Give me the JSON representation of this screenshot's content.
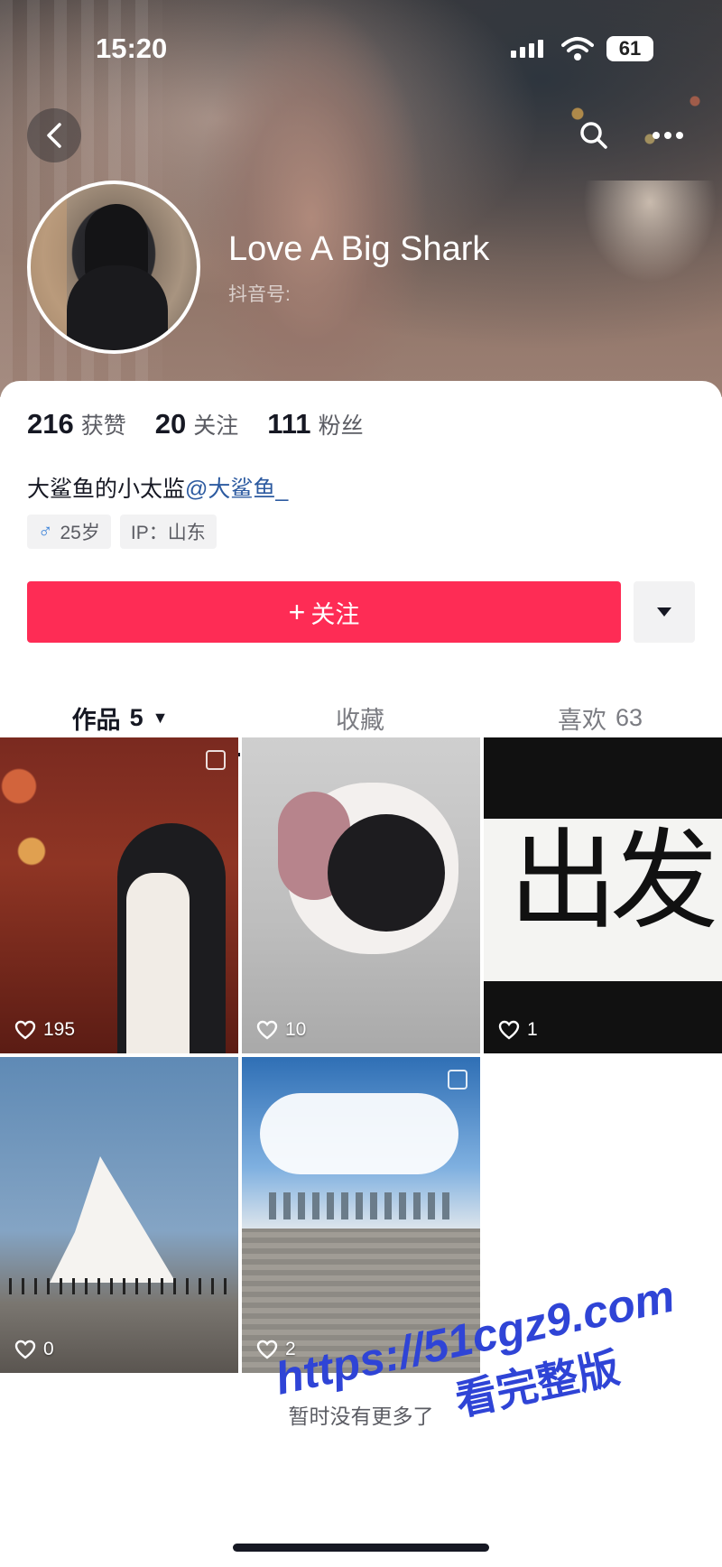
{
  "status_bar": {
    "time": "15:20",
    "battery": "61"
  },
  "profile": {
    "name": "Love A Big Shark",
    "douyin_id_label": "抖音号:",
    "stats": [
      {
        "value": "216",
        "label": "获赞"
      },
      {
        "value": "20",
        "label": "关注"
      },
      {
        "value": "111",
        "label": "粉丝"
      }
    ],
    "bio_text": "大鲨鱼的小太监",
    "bio_mention": "@大鲨鱼_",
    "tags": {
      "gender_icon": "♂",
      "age": "25岁",
      "ip": "IP：山东"
    }
  },
  "actions": {
    "follow_plus": "+",
    "follow_label": "关注"
  },
  "tabs": [
    {
      "label": "作品",
      "count": "5",
      "caret": "▼"
    },
    {
      "label": "收藏"
    },
    {
      "label": "喜欢",
      "count": "63"
    }
  ],
  "videos": [
    {
      "likes": "195"
    },
    {
      "likes": "10"
    },
    {
      "likes": "1",
      "handwriting": [
        "出",
        "发"
      ]
    },
    {
      "likes": "0"
    },
    {
      "likes": "2"
    }
  ],
  "footer": {
    "no_more": "暂时没有更多了"
  },
  "watermark": {
    "line1": "https://51cgz9.com",
    "line2": "看完整版"
  },
  "colors": {
    "follow_button": "#fe2c55",
    "mention": "#2c5aa0",
    "watermark": "#2f44d6"
  }
}
